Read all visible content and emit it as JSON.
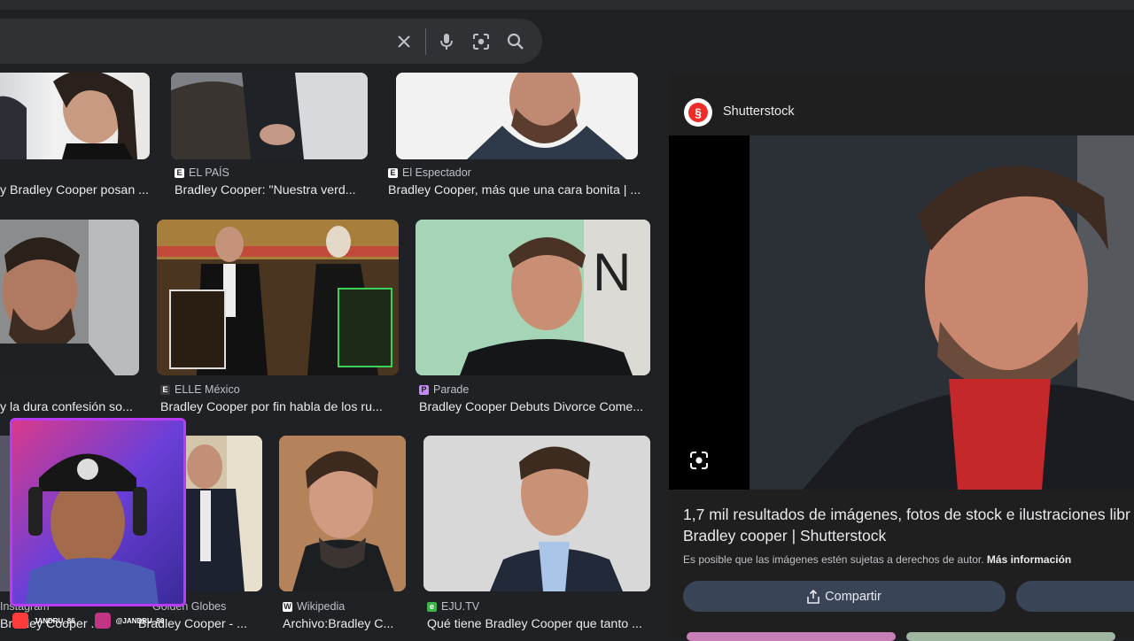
{
  "search": {
    "clear_icon": "close-icon",
    "mic_icon": "mic-icon",
    "lens_icon": "lens-icon",
    "search_icon": "search-icon"
  },
  "grid": [
    {
      "source": "",
      "caption": "y Bradley Cooper posan ..."
    },
    {
      "source": "EL PAÍS",
      "caption": "Bradley Cooper: \"Nuestra verd..."
    },
    {
      "source": "El Espectador",
      "caption": "Bradley Cooper, más que una cara bonita | ..."
    },
    {
      "source": "",
      "caption": "y la dura confesión so..."
    },
    {
      "source": "ELLE México",
      "caption": "Bradley Cooper por fin habla de los ru..."
    },
    {
      "source": "Parade",
      "caption": "Bradley Cooper Debuts Divorce Come..."
    },
    {
      "source": "Instagram",
      "caption": "Bradley Cooper ..."
    },
    {
      "source": "Golden Globes",
      "caption": "Bradley Cooper - ..."
    },
    {
      "source": "Wikipedia",
      "caption": "Archivo:Bradley C..."
    },
    {
      "source": "EJU.TV",
      "caption": "Qué tiene Bradley Cooper que tanto ..."
    }
  ],
  "panel": {
    "source_name": "Shutterstock",
    "title_line1": "1,7 mil resultados de imágenes, fotos de stock e ilustraciones libr",
    "title_line2": "Bradley cooper | Shutterstock",
    "copyright_note": "Es posible que las imágenes estén sujetas a derechos de autor.",
    "more_info": "Más información",
    "share_label": "Compartir"
  },
  "overlay": {
    "handle1": "JANDRU_86",
    "handle2": "@JANDRU_86"
  },
  "colors": {
    "background": "#202124",
    "searchbar": "#303134",
    "accent_purple": "#b93cf5",
    "button": "#394457"
  }
}
